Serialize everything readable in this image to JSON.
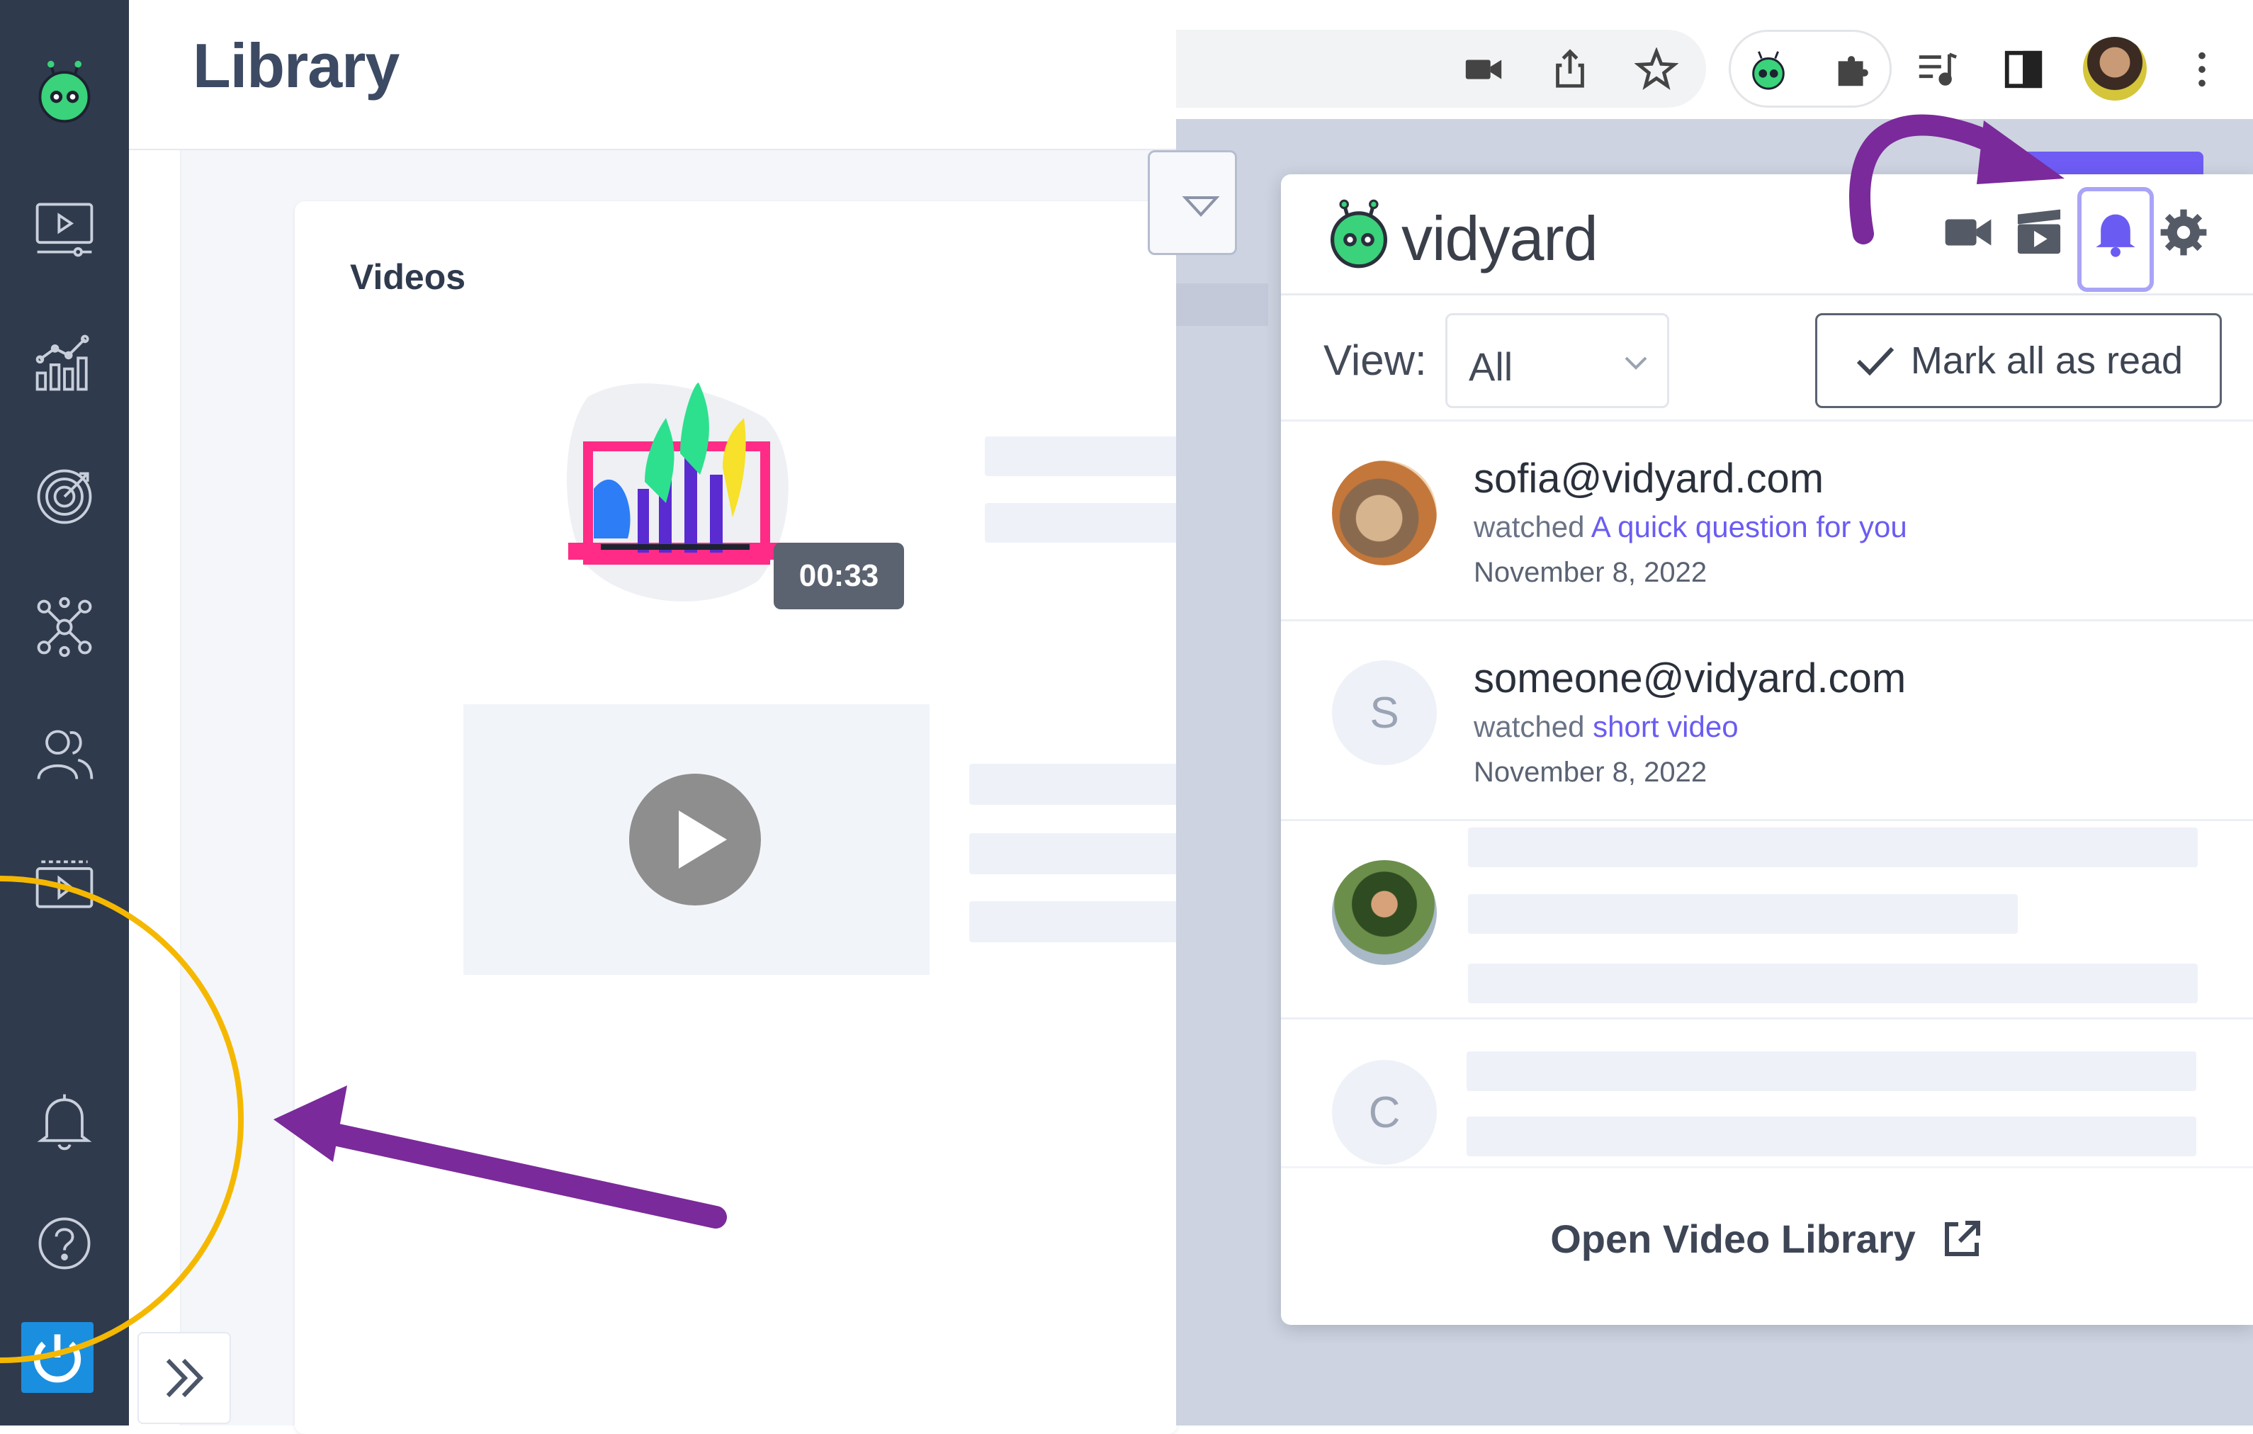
{
  "header": {
    "title": "Library"
  },
  "sidebar": {
    "items": [
      {
        "icon": "vidyard-logo-icon"
      },
      {
        "icon": "video-screen-icon"
      },
      {
        "icon": "analytics-chart-icon"
      },
      {
        "icon": "target-icon"
      },
      {
        "icon": "network-icon"
      },
      {
        "icon": "users-icon"
      },
      {
        "icon": "playlist-icon"
      },
      {
        "icon": "bell-icon"
      },
      {
        "icon": "help-icon"
      },
      {
        "icon": "power-icon"
      }
    ]
  },
  "library": {
    "section_title": "Videos",
    "video_duration": "00:33"
  },
  "extension_panel": {
    "brand": "vidyard",
    "view_label": "View:",
    "view_value": "All",
    "mark_all_label": "Mark all as read",
    "notifications": [
      {
        "email": "sofia@vidyard.com",
        "verb": "watched",
        "video": "A quick question for you",
        "date": "November 8, 2022",
        "avatar": "photo"
      },
      {
        "email": "someone@vidyard.com",
        "verb": "watched",
        "video": "short video",
        "date": "November 8, 2022",
        "avatar_letter": "S"
      },
      {
        "avatar": "photo"
      },
      {
        "avatar_letter": "C"
      }
    ],
    "footer_link": "Open Video Library"
  },
  "colors": {
    "sidebar_bg": "#2f3a4d",
    "accent_purple": "#6a5cf2",
    "annotation_purple": "#7a2a9a",
    "highlight_circle": "#f5b800",
    "brand_green": "#3ad27a"
  }
}
